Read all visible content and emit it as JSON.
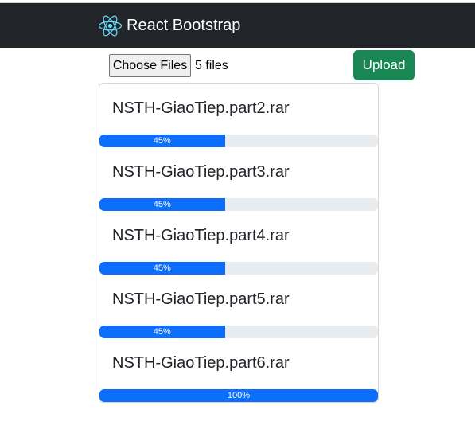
{
  "navbar": {
    "brand": "React Bootstrap",
    "logo_icon": "react-atom-icon",
    "background": "#212529"
  },
  "upload": {
    "choose_label": "Choose Files",
    "file_count": "5 files",
    "upload_label": "Upload"
  },
  "colors": {
    "progress": "#0d6efd",
    "track": "#e9ecef",
    "success": "#198754",
    "react": "#61dafb"
  },
  "files": [
    {
      "name": "NSTH-GiaoTiep.part2.rar",
      "progress_label": "45%",
      "progress": 0.45
    },
    {
      "name": "NSTH-GiaoTiep.part3.rar",
      "progress_label": "45%",
      "progress": 0.45
    },
    {
      "name": "NSTH-GiaoTiep.part4.rar",
      "progress_label": "45%",
      "progress": 0.45
    },
    {
      "name": "NSTH-GiaoTiep.part5.rar",
      "progress_label": "45%",
      "progress": 0.45
    },
    {
      "name": "NSTH-GiaoTiep.part6.rar",
      "progress_label": "100%",
      "progress": 1.0
    }
  ]
}
